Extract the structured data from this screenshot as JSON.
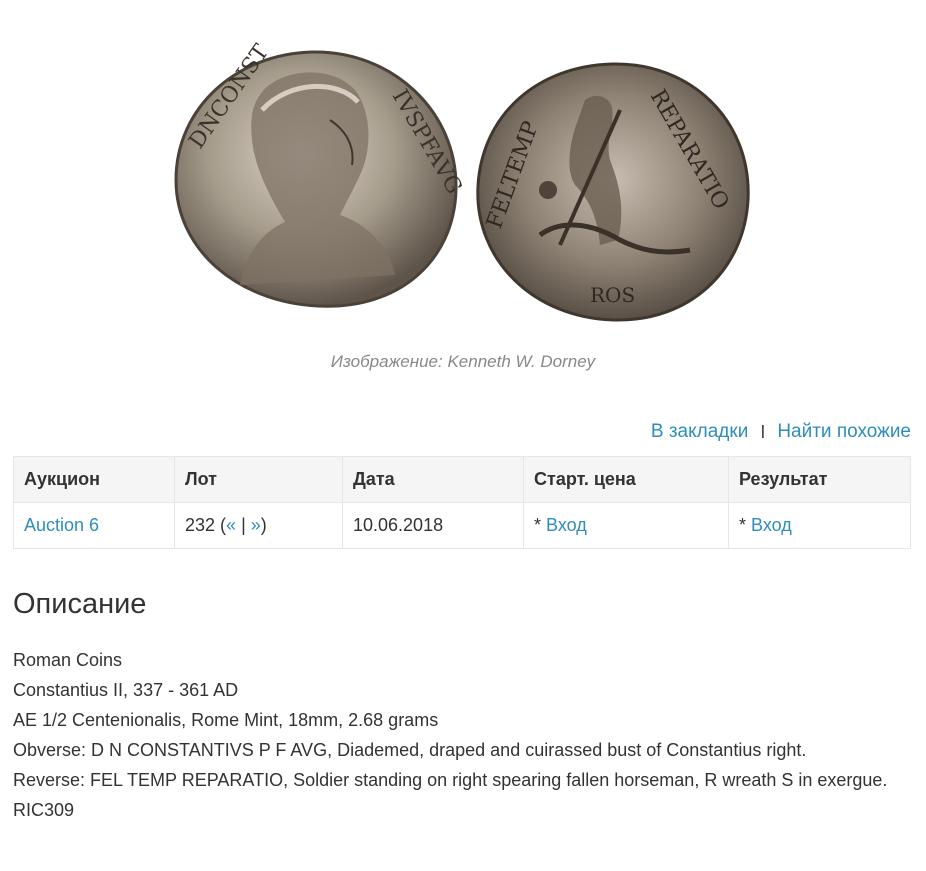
{
  "image": {
    "caption": "Изображение: Kenneth W. Dorney"
  },
  "actions": {
    "bookmark_label": "В закладки",
    "separator": "I",
    "similar_label": "Найти похожие"
  },
  "table": {
    "headers": [
      "Аукцион",
      "Лот",
      "Дата",
      "Старт. цена",
      "Результат"
    ],
    "row": {
      "auction": "Auction 6",
      "lot_number": "232",
      "lot_open": " (",
      "prev": "«",
      "lot_sep": " | ",
      "next": "»",
      "lot_close": ")",
      "date": "10.06.2018",
      "start_prefix": "* ",
      "start_link": "Вход",
      "result_prefix": "* ",
      "result_link": "Вход"
    }
  },
  "description": {
    "title": "Описание",
    "lines": [
      "Roman Coins",
      "Constantius II, 337 - 361 AD",
      "AE 1/2 Centenionalis, Rome Mint, 18mm, 2.68 grams",
      "Obverse: D N CONSTANTIVS P F AVG, Diademed, draped and cuirassed bust of Constantius right.",
      "Reverse: FEL TEMP REPARATIO, Soldier standing on right spearing fallen horseman, R wreath S in exergue.",
      "RIC309"
    ]
  }
}
